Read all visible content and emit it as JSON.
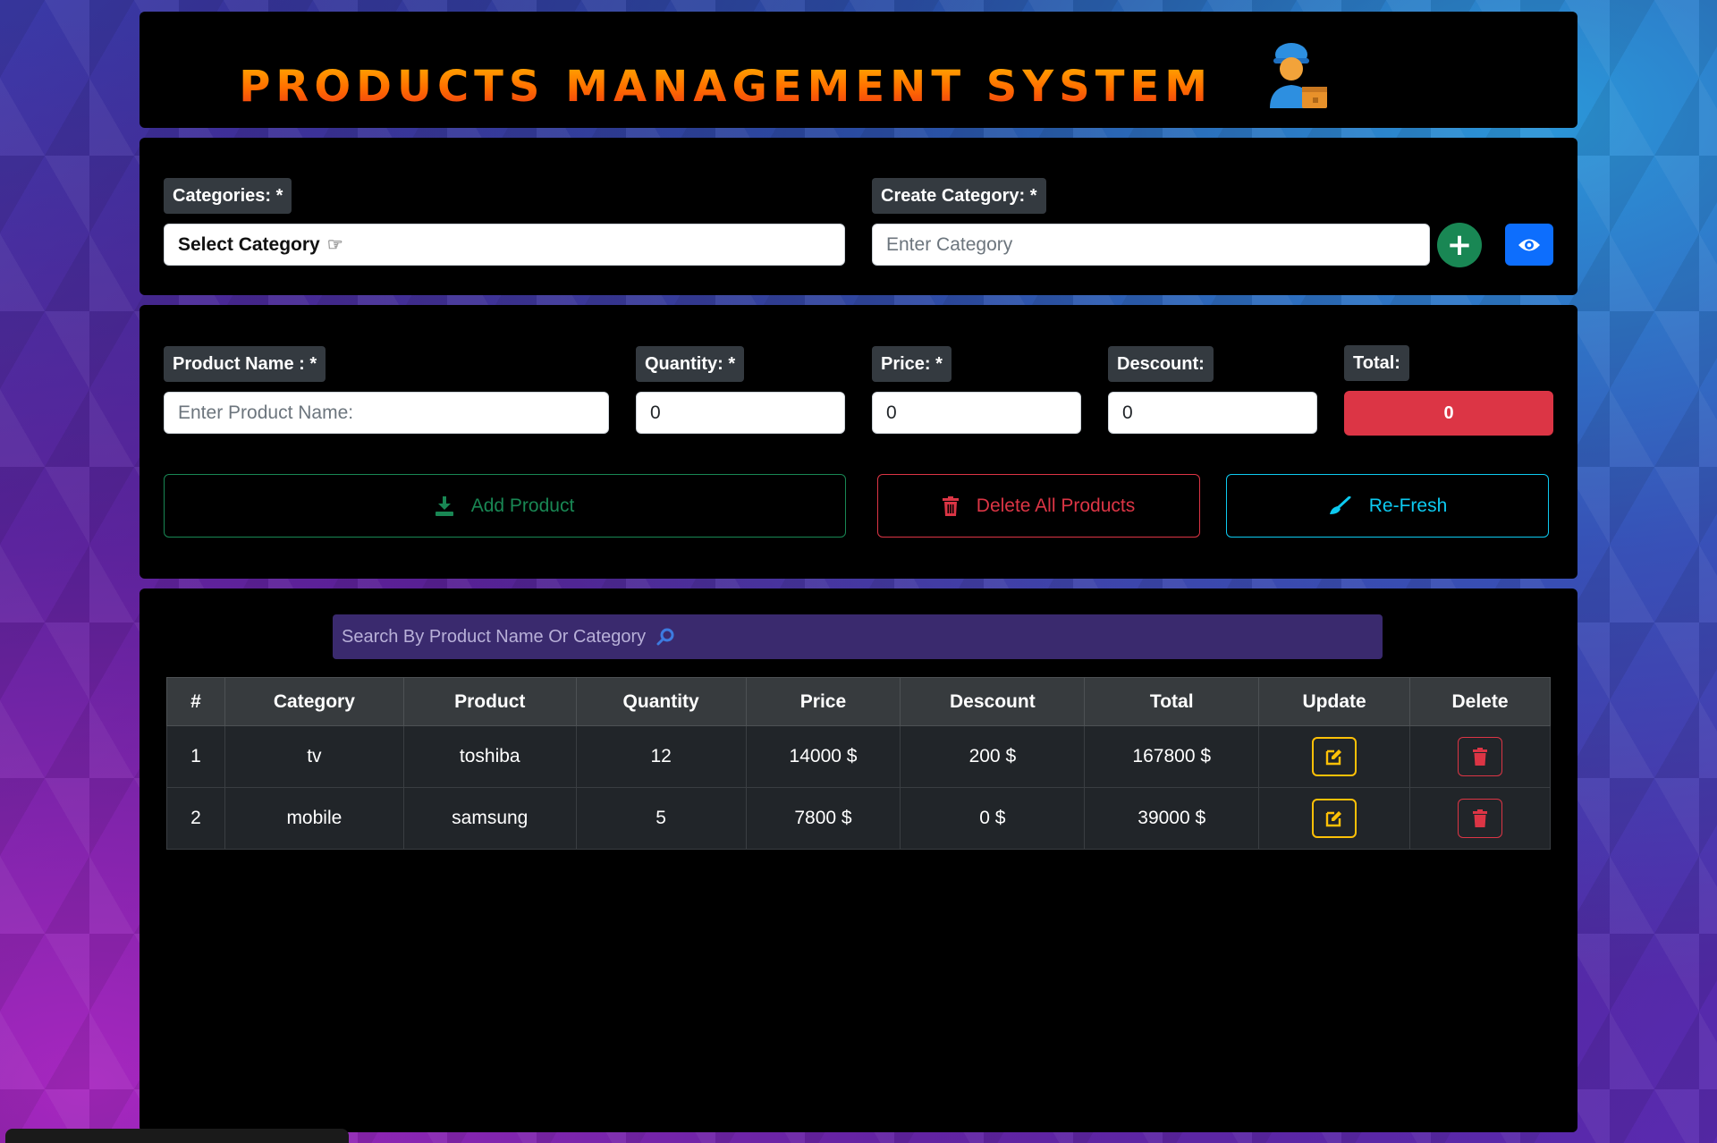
{
  "header": {
    "title": "PRODUCTS MANAGEMENT SYSTEM",
    "icon": "delivery-worker-icon"
  },
  "category": {
    "select_label": "Categories: *",
    "select_value": "Select Category",
    "select_icon": "pointing-hand-icon",
    "create_label": "Create Category: *",
    "create_placeholder": "Enter Category",
    "add_icon": "plus-icon",
    "view_icon": "eye-icon"
  },
  "product_form": {
    "name_label": "Product Name : *",
    "name_placeholder": "Enter Product Name:",
    "quantity_label": "Quantity: *",
    "quantity_value": "0",
    "price_label": "Price: *",
    "price_value": "0",
    "discount_label": "Descount:",
    "discount_value": "0",
    "total_label": "Total:",
    "total_value": "0"
  },
  "actions": {
    "add_label": "Add Product",
    "delete_all_label": "Delete All Products",
    "refresh_label": "Re-Fresh"
  },
  "search": {
    "placeholder": "Search By Product Name Or Category",
    "icon": "magnifier-icon"
  },
  "table": {
    "headers": [
      "#",
      "Category",
      "Product",
      "Quantity",
      "Price",
      "Descount",
      "Total",
      "Update",
      "Delete"
    ],
    "rows": [
      {
        "num": "1",
        "category": "tv",
        "product": "toshiba",
        "quantity": "12",
        "price": "14000 $",
        "discount": "200 $",
        "total": "167800 $"
      },
      {
        "num": "2",
        "category": "mobile",
        "product": "samsung",
        "quantity": "5",
        "price": "7800 $",
        "discount": "0 $",
        "total": "39000 $"
      }
    ]
  },
  "colors": {
    "success": "#198754",
    "danger": "#dc3545",
    "info": "#0dcaf0",
    "primary": "#0d6efd",
    "warning": "#ffc107",
    "title_gradient_start": "#ffb300",
    "title_gradient_end": "#e8321a"
  }
}
